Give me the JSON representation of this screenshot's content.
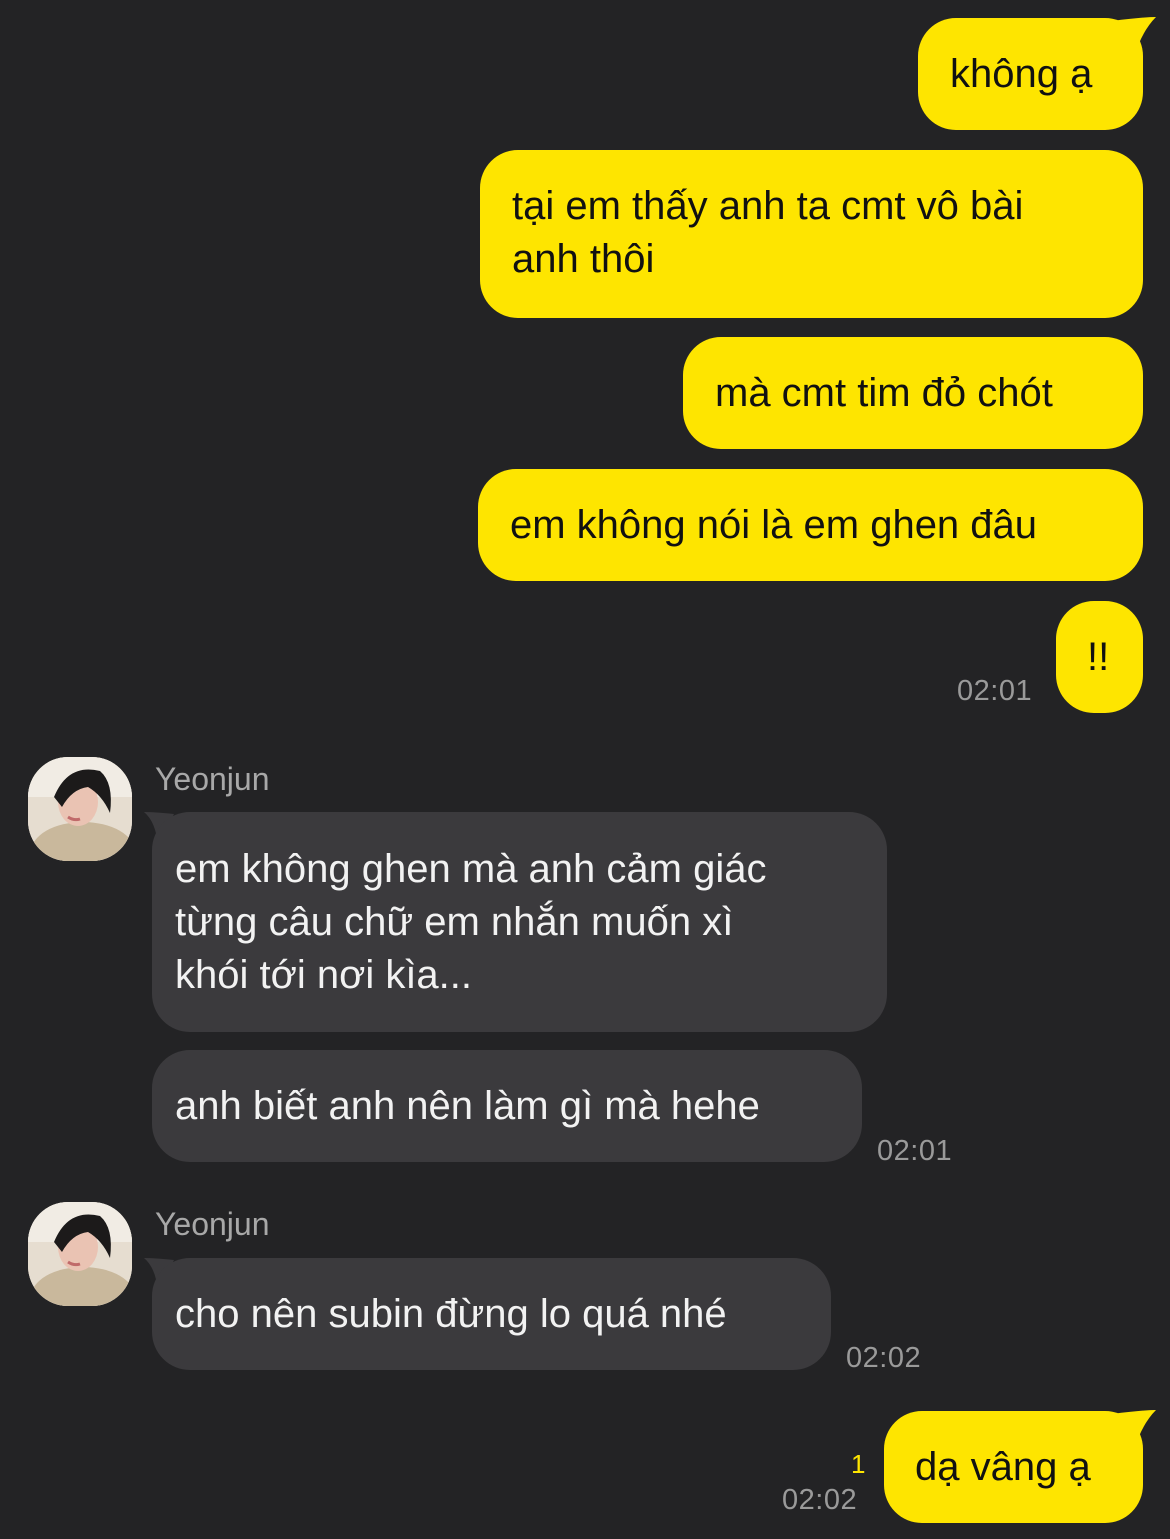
{
  "colors": {
    "background": "#232325",
    "outgoing_bubble": "#FEE500",
    "incoming_bubble": "#3B3A3D",
    "timestamp": "#9A9A9A",
    "unread_count": "#FEE500"
  },
  "messages": {
    "out1": "không ạ",
    "out2_line1": "tại em thấy anh ta cmt vô bài",
    "out2_line2": "anh thôi",
    "out3": "mà cmt tim đỏ chót",
    "out4": "em không nói là em ghen đâu",
    "out5": "!!",
    "out5_time": "02:01",
    "group1_sender": "Yeonjun",
    "in1_line1": "em không ghen mà anh cảm giác",
    "in1_line2": "từng câu chữ em nhắn muốn xì",
    "in1_line3": "khói tới nơi kìa...",
    "in2": "anh biết anh nên làm gì mà hehe",
    "in2_time": "02:01",
    "group2_sender": "Yeonjun",
    "in3": "cho nên subin đừng lo quá nhé",
    "in3_time": "02:02",
    "out6": "dạ vâng ạ",
    "out6_unread": "1",
    "out6_time": "02:02"
  },
  "icons": {
    "avatar": "profile-photo-avatar"
  }
}
